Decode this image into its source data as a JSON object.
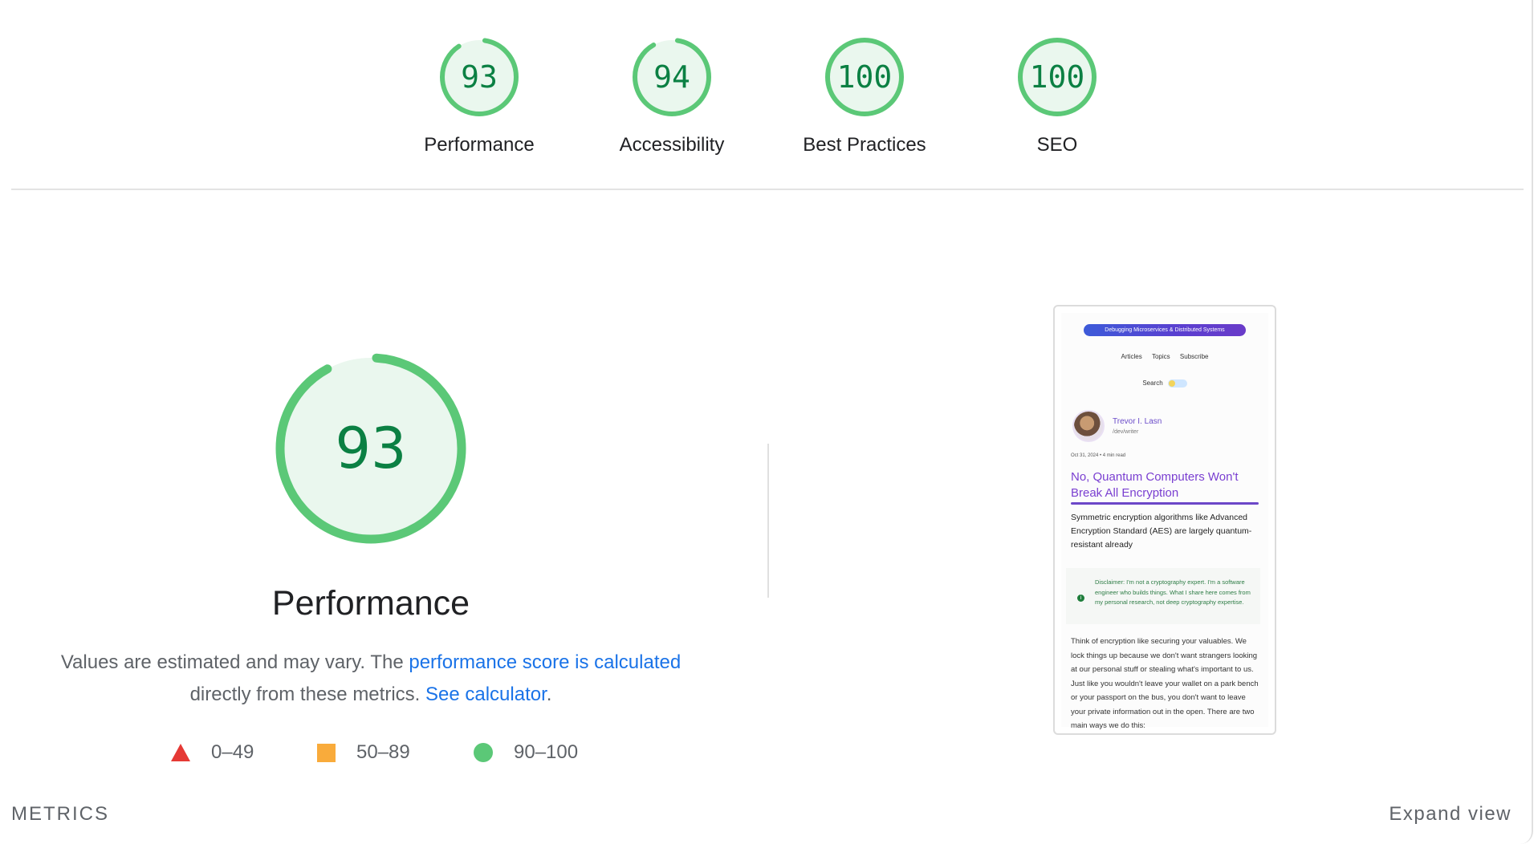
{
  "categories": [
    {
      "label": "Performance",
      "score": "93",
      "value": 93
    },
    {
      "label": "Accessibility",
      "score": "94",
      "value": 94
    },
    {
      "label": "Best Practices",
      "score": "100",
      "value": 100
    },
    {
      "label": "SEO",
      "score": "100",
      "value": 100
    }
  ],
  "performance": {
    "score": "93",
    "value": 93,
    "title": "Performance",
    "desc_prefix": "Values are estimated and may vary. The ",
    "desc_link1": "performance score is calculated",
    "desc_middle": " directly from these metrics. ",
    "desc_link2": "See calculator",
    "desc_suffix": "."
  },
  "legend": [
    {
      "shape": "triangle",
      "range": "0–49",
      "color": "#e53935"
    },
    {
      "shape": "square",
      "range": "50–89",
      "color": "#f9ab3b"
    },
    {
      "shape": "circle",
      "range": "90–100",
      "color": "#5bc877"
    }
  ],
  "colors": {
    "pass_stroke": "#5bc877",
    "pass_fill": "#eaf7ee",
    "pass_text": "#0b8043",
    "link": "#1a73e8"
  },
  "screenshot": {
    "banner": "Debugging Microservices & Distributed Systems",
    "nav": [
      "Articles",
      "Topics",
      "Subscribe"
    ],
    "search": "Search",
    "author": "Trevor I. Lasn",
    "handle": "/dev/writer",
    "meta": "Oct 31, 2024  •  4 min read",
    "title": "No, Quantum Computers Won't Break All Encryption",
    "lead": "Symmetric encryption algorithms like Advanced Encryption Standard (AES) are largely quantum-resistant already",
    "note": "Disclaimer: I'm not a cryptography expert. I'm a software engineer who builds things. What I share here comes from my personal research, not deep cryptography expertise.",
    "body": "Think of encryption like securing your valuables. We lock things up because we don't want strangers looking at our personal stuff or stealing what's important to us. Just like you wouldn't leave your wallet on a park bench or your passport on the bus, you don't want to leave your private information out in the open. There are two main ways we do this:"
  },
  "metrics_heading": "METRICS",
  "expand_label": "Expand view"
}
